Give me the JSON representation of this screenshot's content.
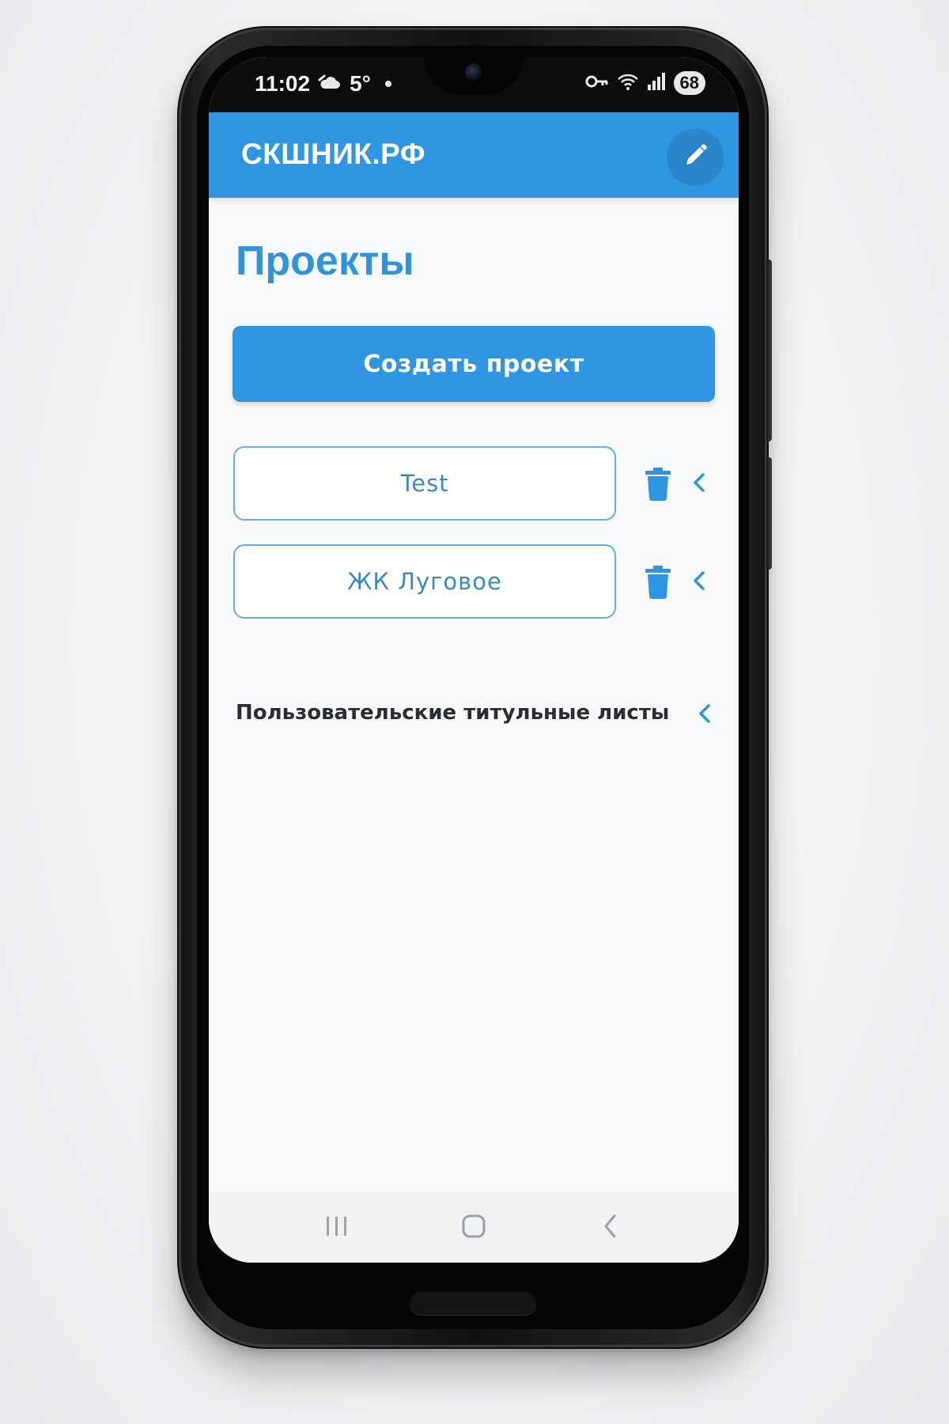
{
  "status_bar": {
    "time": "11:02",
    "weather_icon": "cloud-weather-icon",
    "temperature": "5°",
    "battery_level": "68",
    "icons": [
      "key-icon",
      "wifi-icon",
      "signal-icon",
      "battery-icon"
    ]
  },
  "app_bar": {
    "title": "СКШНИК.РФ",
    "edit_icon": "pencil-icon"
  },
  "page": {
    "title": "Проекты",
    "create_button_label": "Создать проект"
  },
  "projects": [
    {
      "name": "Test"
    },
    {
      "name": "ЖК Луговое"
    }
  ],
  "title_sheets": {
    "label": "Пользовательские титульные листы"
  },
  "nav_bar": {
    "icons": [
      "recent-apps-icon",
      "home-icon",
      "back-icon"
    ]
  },
  "colors": {
    "primary": "#2f97e1",
    "primary_text": "#2f93dd",
    "card_border": "#62aee6",
    "card_text": "#3a8cc9",
    "body_text": "#2a2d33",
    "screen_bg": "#f7f8fa"
  }
}
